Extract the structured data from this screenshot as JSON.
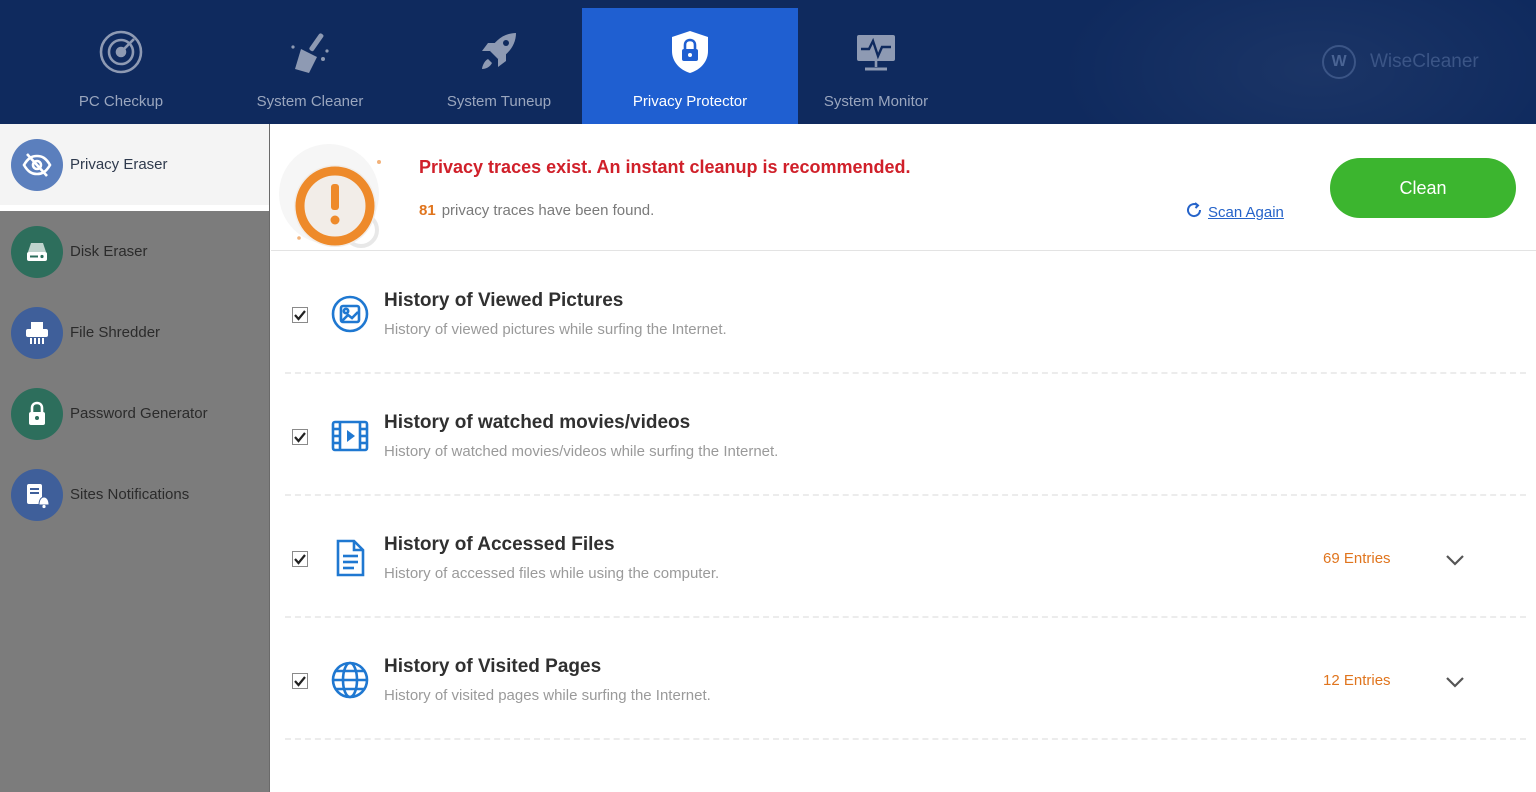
{
  "nav": {
    "tabs": [
      {
        "label": "PC Checkup",
        "icon": "radar-target-icon"
      },
      {
        "label": "System Cleaner",
        "icon": "broom-icon"
      },
      {
        "label": "System Tuneup",
        "icon": "rocket-icon"
      },
      {
        "label": "Privacy Protector",
        "icon": "shield-lock-icon",
        "active": true
      },
      {
        "label": "System Monitor",
        "icon": "monitor-pulse-icon"
      }
    ],
    "brand": {
      "logo": "W",
      "name": "WiseCleaner"
    }
  },
  "sidebar": {
    "items": [
      {
        "label": "Privacy Eraser",
        "icon": "eye-slash-icon",
        "active": true
      },
      {
        "label": "Disk Eraser",
        "icon": "disk-icon"
      },
      {
        "label": "File Shredder",
        "icon": "shredder-icon"
      },
      {
        "label": "Password Generator",
        "icon": "padlock-icon"
      },
      {
        "label": "Sites Notifications",
        "icon": "notification-bell-icon"
      }
    ]
  },
  "alert": {
    "title": "Privacy traces exist. An instant cleanup is recommended.",
    "count": "81",
    "subtitle": "privacy traces have been found.",
    "scan_again": "Scan Again",
    "clean": "Clean"
  },
  "items": [
    {
      "title": "History of Viewed Pictures",
      "desc": "History of viewed pictures while surfing the Internet.",
      "entries": "",
      "checked": true,
      "icon": "picture-icon"
    },
    {
      "title": "History of watched movies/videos",
      "desc": "History of watched movies/videos while surfing the Internet.",
      "entries": "",
      "checked": true,
      "icon": "film-icon"
    },
    {
      "title": "History of Accessed Files",
      "desc": "History of accessed files while using the computer.",
      "entries": "69 Entries",
      "checked": true,
      "icon": "document-icon"
    },
    {
      "title": "History of Visited Pages",
      "desc": "History of visited pages while surfing the Internet.",
      "entries": "12 Entries",
      "checked": true,
      "icon": "globe-icon"
    }
  ],
  "colors": {
    "nav_bg": "#0f2a5e",
    "nav_active": "#1f5fd1",
    "alert_red": "#d0202a",
    "orange": "#e0751e",
    "clean_green": "#3cb52f",
    "link_blue": "#2563c9"
  }
}
